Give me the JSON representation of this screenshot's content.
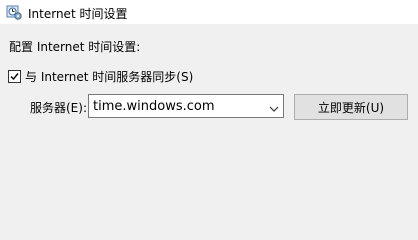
{
  "window": {
    "title": "Internet 时间设置",
    "icon": "clock-settings-icon"
  },
  "dialog": {
    "heading": "配置 Internet 时间设置:",
    "sync_checkbox": {
      "label": "与 Internet 时间服务器同步(S)",
      "checked": true
    },
    "server_label": "服务器(E):",
    "server_value": "time.windows.com",
    "update_button": "立即更新(U)"
  }
}
